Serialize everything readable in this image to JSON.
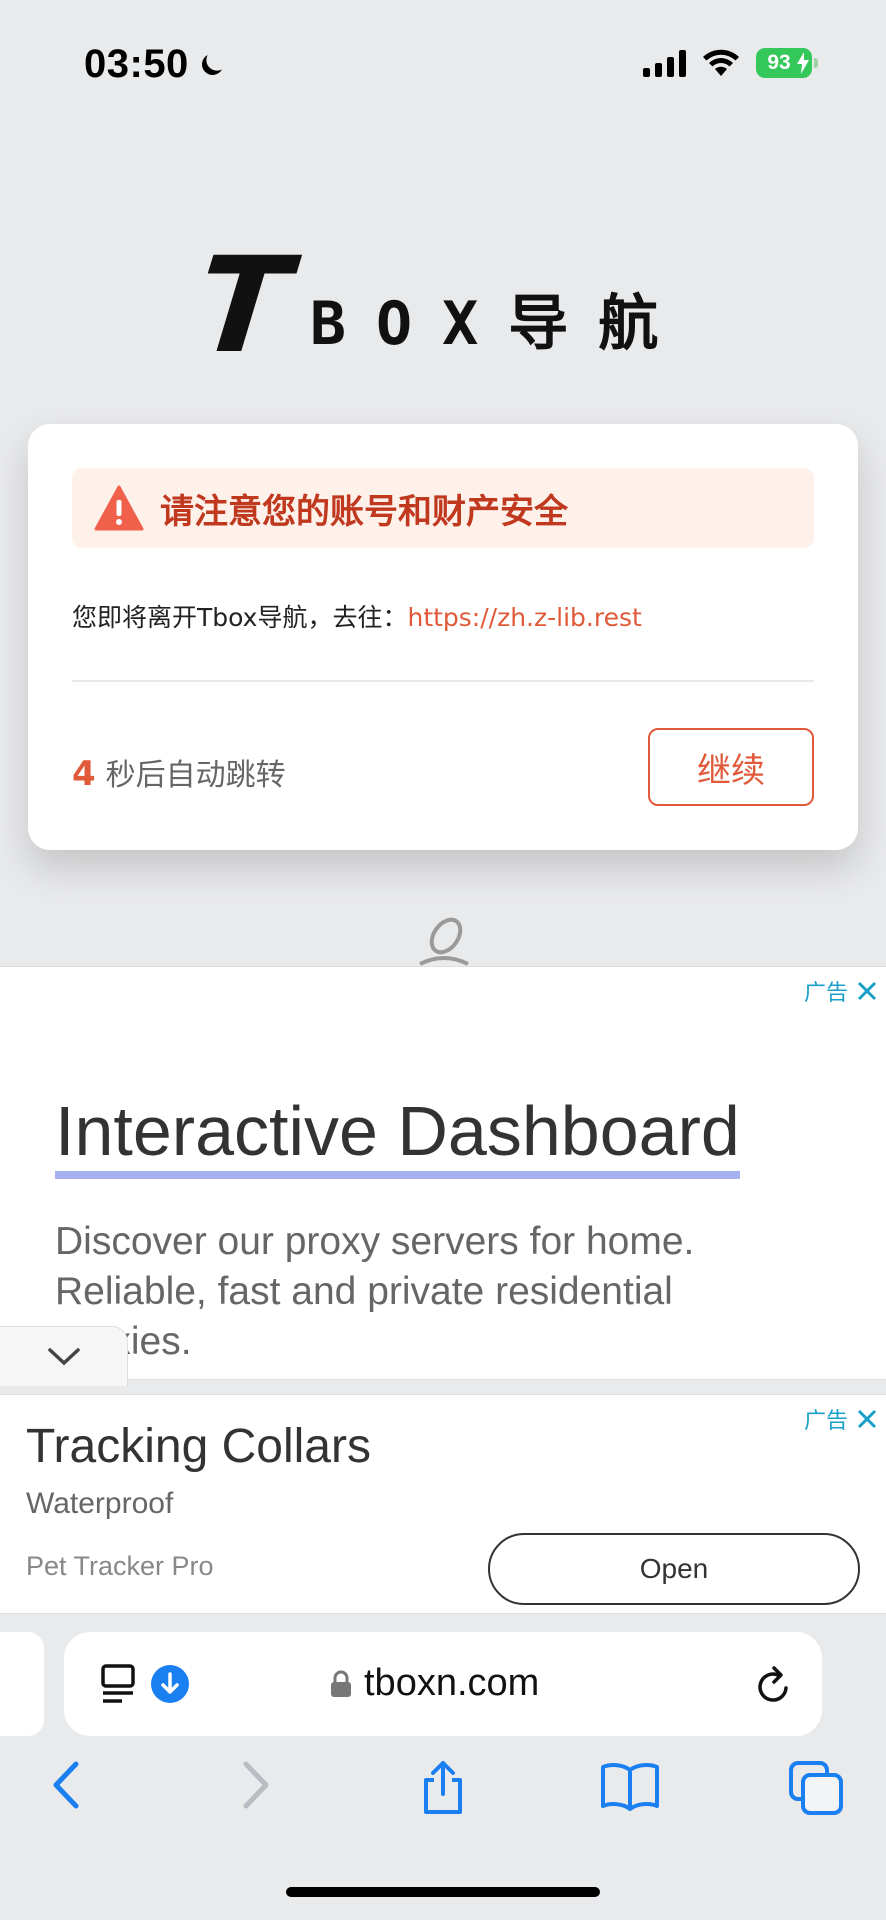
{
  "status_bar": {
    "time": "03:50",
    "battery": "93"
  },
  "logo": {
    "t": "T",
    "rest": "BOX导航"
  },
  "card": {
    "warning": "请注意您的账号和财产安全",
    "leave_prefix": "您即将离开Tbox导航，去往：",
    "leave_url": "https://zh.z-lib.rest",
    "countdown_number": "4",
    "countdown_text": "秒后自动跳转",
    "continue_label": "继续"
  },
  "ad1": {
    "label": "广告",
    "title": "Interactive Dashboard",
    "description": "Discover our proxy servers for home. Reliable, fast and private residential proxies."
  },
  "ad2": {
    "label": "广告",
    "title": "Tracking Collars",
    "subtitle": "Waterproof",
    "brand": "Pet Tracker Pro",
    "open_label": "Open"
  },
  "browser": {
    "url": "tboxn.com"
  },
  "colors": {
    "accent": "#e05a3a",
    "ad_label": "#1aa0c8",
    "ios_blue": "#1a7ff0",
    "battery": "#34c759"
  },
  "icons": [
    "moon-icon",
    "signal-icon",
    "wifi-icon",
    "battery-icon",
    "warning-icon",
    "ad-close-icon",
    "chevron-down-icon",
    "reader-icon",
    "download-icon",
    "lock-icon",
    "reload-icon",
    "back-icon",
    "forward-icon",
    "share-icon",
    "bookmarks-icon",
    "tabs-icon"
  ]
}
